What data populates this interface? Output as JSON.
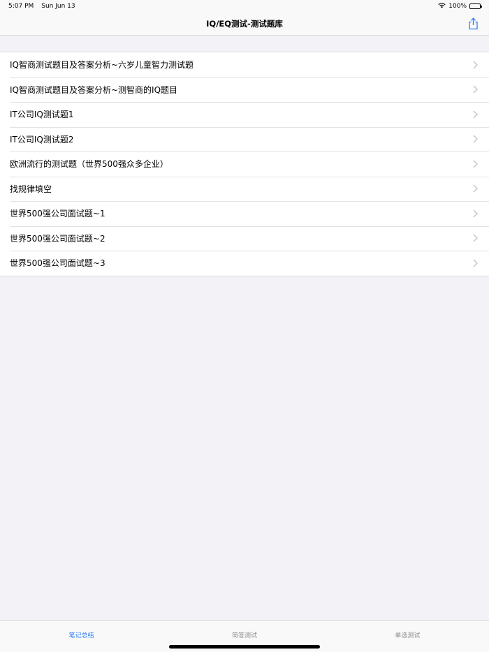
{
  "status_bar": {
    "time": "5:07 PM",
    "date": "Sun Jun 13",
    "battery": "100%"
  },
  "nav": {
    "title": "IQ/EQ测试-测试题库"
  },
  "list": {
    "items": [
      {
        "label": "IQ智商测试题目及答案分析~六岁儿童智力测试题"
      },
      {
        "label": "IQ智商测试题目及答案分析~测智商的IQ题目"
      },
      {
        "label": "IT公司IQ测试题1"
      },
      {
        "label": "IT公司IQ测试题2"
      },
      {
        "label": "欧洲流行的测试题（世界500强众多企业）"
      },
      {
        "label": " 找规律填空"
      },
      {
        "label": "世界500强公司面试题~1"
      },
      {
        "label": "世界500强公司面试题~2"
      },
      {
        "label": "世界500强公司面试题~3"
      }
    ]
  },
  "tabs": [
    {
      "label": "笔记总结",
      "active": true
    },
    {
      "label": "简答测试",
      "active": false
    },
    {
      "label": "单选测试",
      "active": false
    }
  ],
  "colors": {
    "accent": "#2f7cf6",
    "inactive_tab": "#8e8e93",
    "background": "#f2f2f7"
  }
}
